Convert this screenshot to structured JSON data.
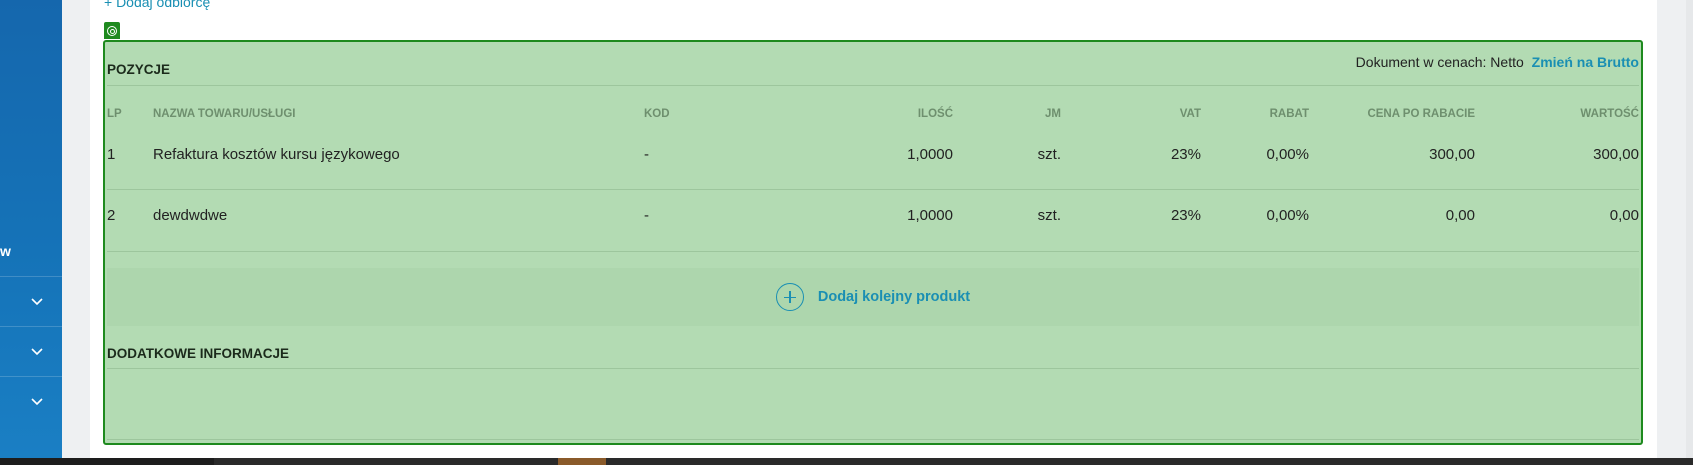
{
  "header": {
    "add_recipient": "+ Dodaj odbiorcę"
  },
  "sidebar": {
    "visible_letter": "w"
  },
  "pricing": {
    "label": "Dokument w cenach: Netto",
    "switch_link": "Zmień na Brutto"
  },
  "positions": {
    "title": "POZYCJE",
    "columns": [
      "LP",
      "NAZWA TOWARU/USŁUGI",
      "KOD",
      "ILOŚĆ",
      "JM",
      "VAT",
      "RABAT",
      "CENA PO RABACIE",
      "WARTOŚĆ"
    ],
    "rows": [
      {
        "lp": "1",
        "name": "Refaktura kosztów kursu językowego",
        "code": "-",
        "qty": "1,0000",
        "unit": "szt.",
        "vat": "23%",
        "discount": "0,00%",
        "price": "300,00",
        "value": "300,00"
      },
      {
        "lp": "2",
        "name": "dewdwdwe",
        "code": "-",
        "qty": "1,0000",
        "unit": "szt.",
        "vat": "23%",
        "discount": "0,00%",
        "price": "0,00",
        "value": "0,00"
      }
    ],
    "add_product": "Dodaj kolejny produkt"
  },
  "additional": {
    "title": "DODATKOWE INFORMACJE"
  },
  "colors": {
    "accent": "#1a8fb3",
    "highlight_fill": "#b3dbb3",
    "highlight_border": "#1e8a1e",
    "sidebar": "#1573b8"
  }
}
